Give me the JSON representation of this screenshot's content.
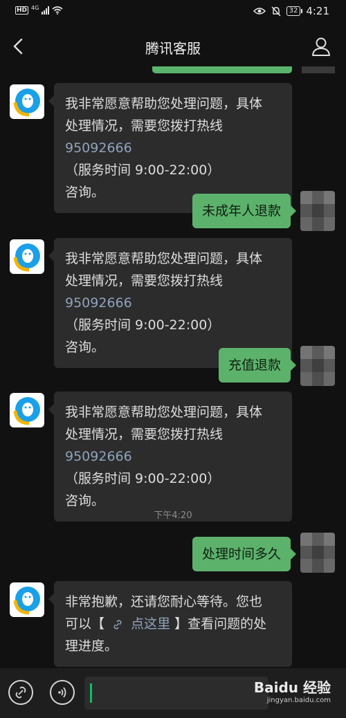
{
  "status_bar": {
    "hd": "HD",
    "network": "4G",
    "battery": "32",
    "time": "4:21"
  },
  "header": {
    "title": "腾讯客服"
  },
  "messages": {
    "m1": {
      "line1": "我非常愿意帮助您处理问题，具体",
      "line2": "处理情况，需要您拨打热线",
      "phone": "95092666",
      "hours": "（服务时间 9:00-22:00）",
      "line4": "咨询。"
    },
    "m2": {
      "text": "未成年人退款"
    },
    "m3": {
      "line1": "我非常愿意帮助您处理问题，具体",
      "line2": "处理情况，需要您拨打热线",
      "phone": "95092666",
      "hours": "（服务时间 9:00-22:00）",
      "line4": "咨询。"
    },
    "m4": {
      "text": "充值退款"
    },
    "m5": {
      "line1": "我非常愿意帮助您处理问题，具体",
      "line2": "处理情况，需要您拨打热线",
      "phone": "95092666",
      "hours": "（服务时间 9:00-22:00）",
      "line4": "咨询。"
    },
    "timestamp": "下午4:20",
    "m6": {
      "text": "处理时间多久"
    },
    "m7": {
      "line1": "非常抱歉，还请您耐心等待。您也",
      "line2_pre": "可以【",
      "link_text": "点这里",
      "line2_post": "】查看问题的处",
      "line3": "理进度。"
    }
  },
  "watermark": {
    "brand": "Baidu 经验",
    "url": "jingyan.baidu.com"
  }
}
